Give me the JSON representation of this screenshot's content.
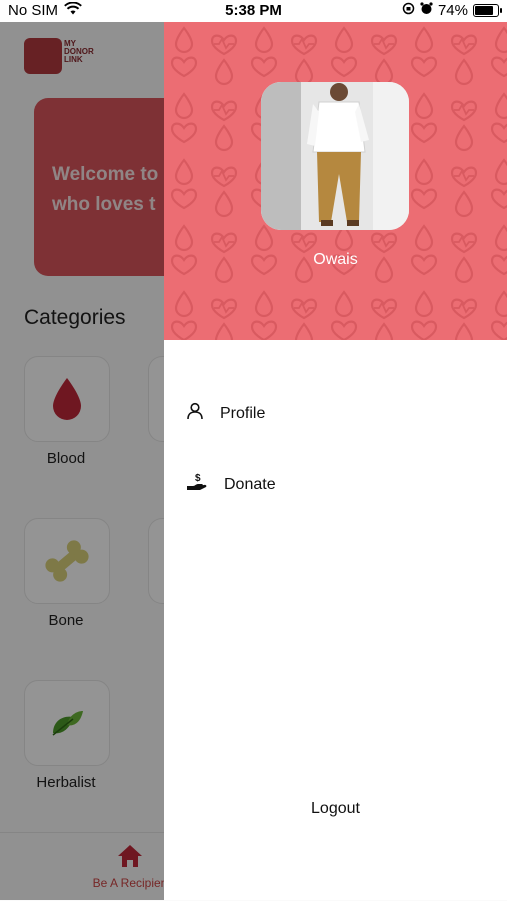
{
  "status_bar": {
    "carrier": "No SIM",
    "time": "5:38 PM",
    "battery_percent": "74%"
  },
  "app": {
    "logo_lines": [
      "MY",
      "DONOR",
      "LINK"
    ],
    "welcome_text": "Welcome to who loves to",
    "welcome_line1": "Welcome to",
    "welcome_line2": "who loves t",
    "categories_title": "Categories",
    "categories": [
      {
        "label": "Blood",
        "icon": "blood-drop-icon"
      },
      {
        "label": "Bone",
        "icon": "bone-icon"
      },
      {
        "label": "Herbalist",
        "icon": "leaf-icon"
      }
    ],
    "bottom_tab_label": "Be A Recipien"
  },
  "drawer": {
    "user_name": "Owais",
    "menu": [
      {
        "label": "Profile",
        "icon": "person-icon"
      },
      {
        "label": "Donate",
        "icon": "donate-hand-icon"
      }
    ],
    "logout_label": "Logout"
  },
  "colors": {
    "drawer_header": "#ec6d73",
    "accent_red": "#d9555c"
  }
}
